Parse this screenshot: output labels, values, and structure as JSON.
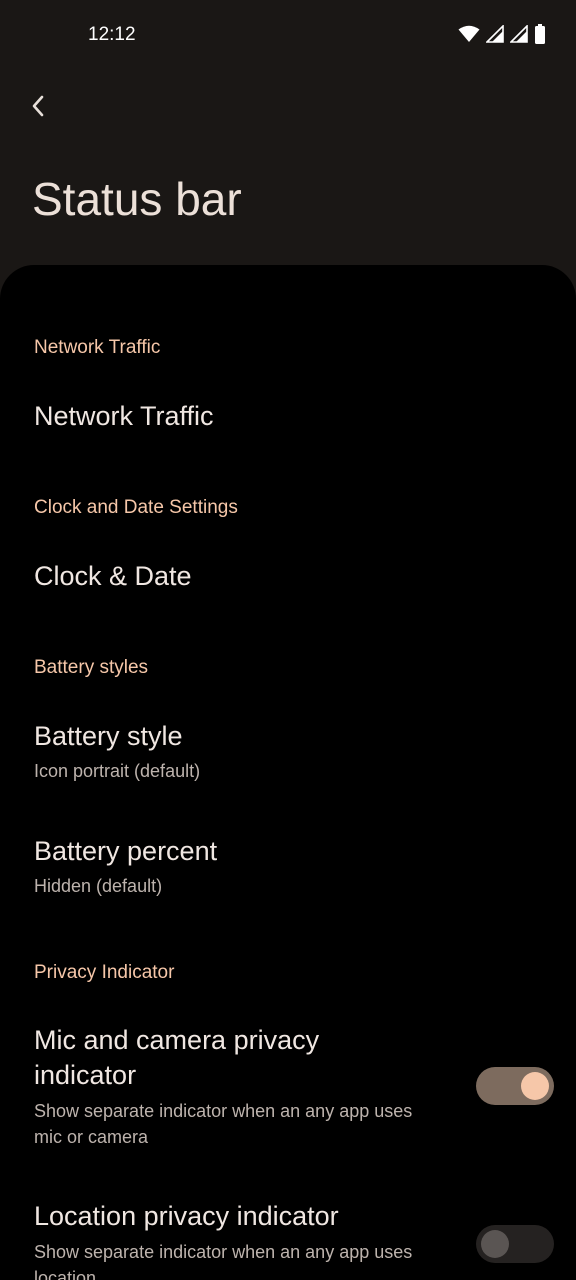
{
  "status_bar": {
    "time": "12:12"
  },
  "page": {
    "title": "Status bar"
  },
  "sections": {
    "network": {
      "header": "Network Traffic",
      "item_title": "Network Traffic"
    },
    "clock": {
      "header": "Clock and Date Settings",
      "item_title": "Clock & Date"
    },
    "battery": {
      "header": "Battery styles",
      "style_title": "Battery style",
      "style_value": "Icon portrait (default)",
      "percent_title": "Battery percent",
      "percent_value": "Hidden (default)"
    },
    "privacy": {
      "header": "Privacy Indicator",
      "mic_title_line1": "Mic and camera privacy",
      "mic_title_line2": "indicator",
      "mic_sub_line1": "Show separate indicator when an any app uses",
      "mic_sub_line2": "mic or camera",
      "mic_enabled": true,
      "location_title": "Location privacy indicator",
      "location_sub_line1": "Show separate indicator when an any app uses",
      "location_sub_line2": "location",
      "location_enabled": false
    }
  },
  "colors": {
    "accent": "#f6c7a9",
    "background": "#000000",
    "header_bg": "#1a1715"
  },
  "icons": [
    "wifi-icon",
    "signal-icon",
    "battery-icon",
    "back-arrow-icon"
  ]
}
